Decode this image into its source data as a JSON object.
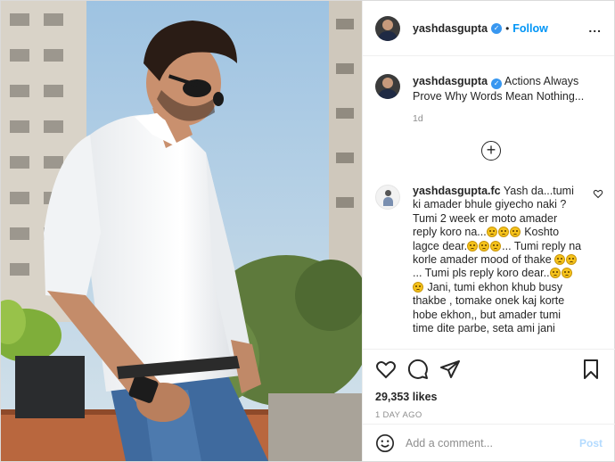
{
  "colors": {
    "link": "#0095f6",
    "verified": "#3897f0",
    "muted": "#8e8e8e",
    "text": "#262626"
  },
  "header": {
    "username": "yashdasgupta",
    "separator": "•",
    "follow_label": "Follow",
    "more_glyph": "..."
  },
  "caption": {
    "username": "yashdasgupta",
    "text": "Actions Always Prove Why Words Mean Nothing...",
    "time": "1d"
  },
  "load_more_glyph": "+",
  "comment": {
    "username": "yashdasgupta.fc",
    "lines": [
      "Yash da...tumi ki",
      "amader bhule giyecho naki ? Tumi",
      "2 week er moto amader reply",
      "koro na...",
      "Koshto lagce dear.",
      "...",
      "Tumi reply na korle amader mood",
      "of thake",
      "... Tumi pls reply",
      "koro dear..",
      "Jani, tumi ekhon khub busy",
      "thakbe , tomake onek kaj korte",
      "hobe ekhon,, but amader tumi",
      "time dite parbe, seta ami jani"
    ]
  },
  "actions": {
    "icons": [
      "heart-icon",
      "comment-icon",
      "share-icon",
      "bookmark-icon"
    ],
    "likes": "29,353 likes",
    "date": "1 DAY AGO"
  },
  "add_comment": {
    "placeholder": "Add a comment...",
    "post_label": "Post"
  }
}
